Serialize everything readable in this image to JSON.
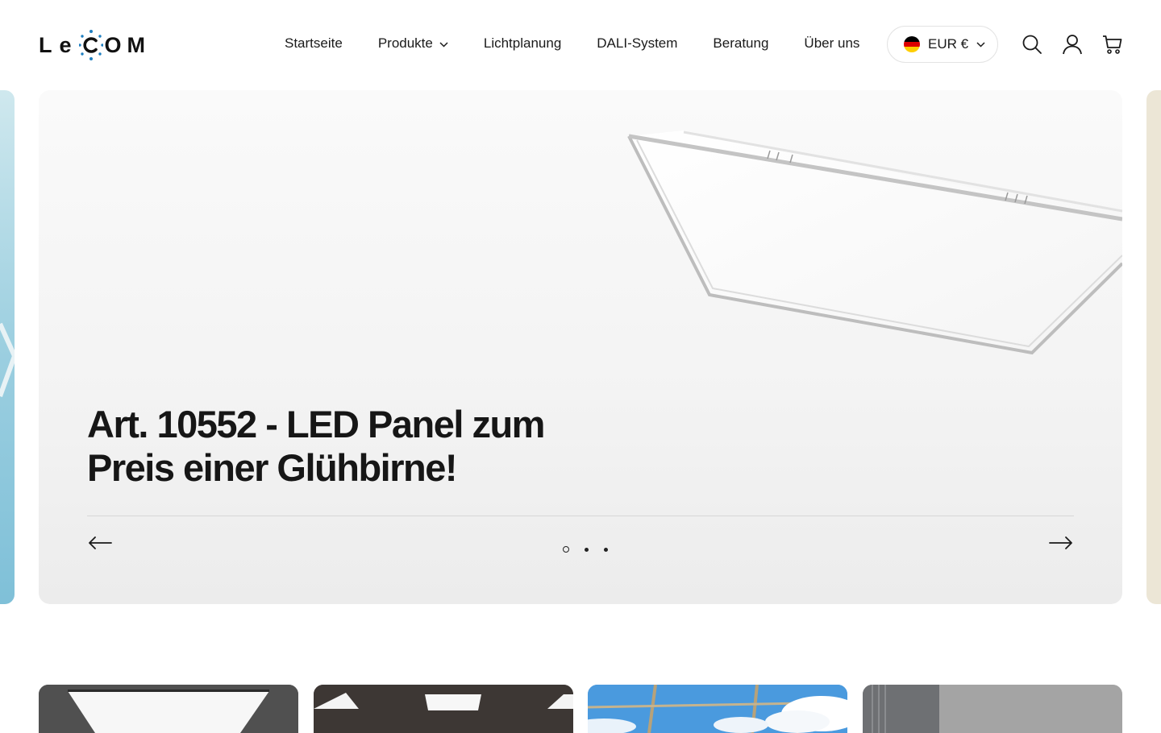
{
  "brand": {
    "logo_text": "LECOM",
    "logo_accent_color": "#1f7fc1"
  },
  "nav": {
    "items": [
      {
        "label": "Startseite"
      },
      {
        "label": "Produkte",
        "has_dropdown": true
      },
      {
        "label": "Lichtplanung"
      },
      {
        "label": "DALI-System"
      },
      {
        "label": "Beratung"
      },
      {
        "label": "Über uns"
      }
    ]
  },
  "currency_selector": {
    "label": "EUR €",
    "flag": "germany-flag",
    "icon": "chevron-down-icon"
  },
  "header_icons": {
    "search": "search-icon",
    "account": "user-icon",
    "cart": "cart-icon"
  },
  "hero": {
    "title": "Art. 10552 - LED Panel zum Preis einer Glühbirne!",
    "slides_count": 3,
    "active_slide": 1,
    "prev_icon": "arrow-left-icon",
    "next_icon": "arrow-right-icon"
  },
  "category_tiles": [
    {
      "image": "ceiling-led-panel"
    },
    {
      "image": "ceiling-recessed-lights"
    },
    {
      "image": "sky-ceiling-panel"
    },
    {
      "image": "interior-wall"
    }
  ]
}
